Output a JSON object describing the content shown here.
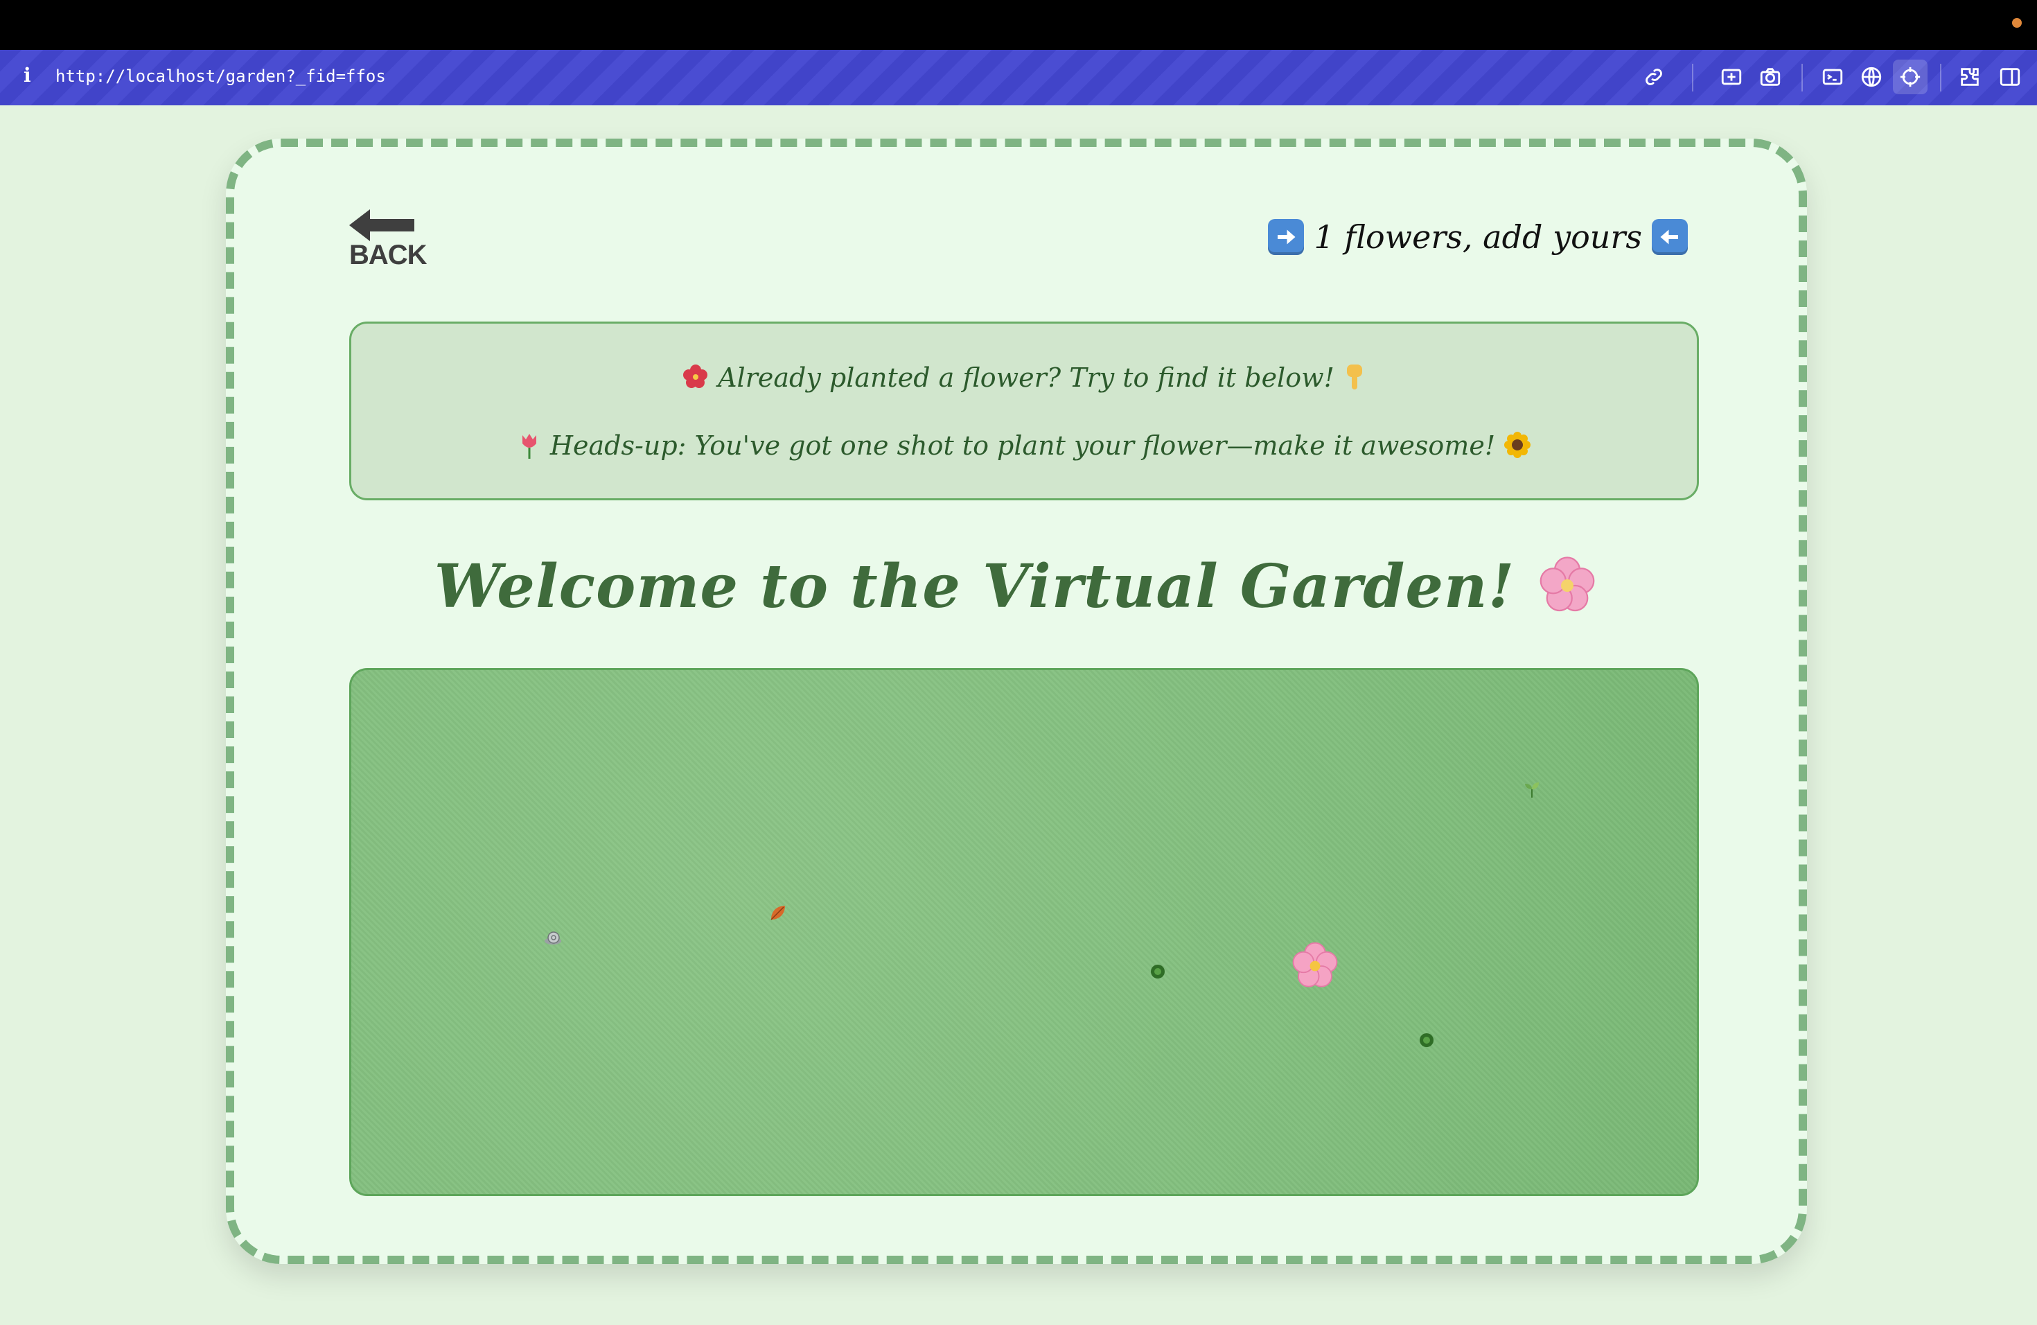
{
  "browser": {
    "info_icon": "i",
    "url": "http://localhost/garden?_fid=ffos"
  },
  "page": {
    "back_label": "BACK",
    "counter_text": "1 flowers, add yours",
    "notice_line1": "Already planted a flower? Try to find it below!",
    "notice_line2": "Heads-up: You've got one shot to plant your flower—make it awesome!",
    "title": "Welcome to the Virtual Garden!"
  },
  "garden": {
    "items": [
      "cherry-blossom",
      "snail",
      "leaf",
      "seedling",
      "sprout",
      "sprout"
    ]
  },
  "colors": {
    "accent": "#4144c9",
    "title": "#3f6b3c",
    "border": "#7fb483",
    "garden": "#82bf7e"
  }
}
